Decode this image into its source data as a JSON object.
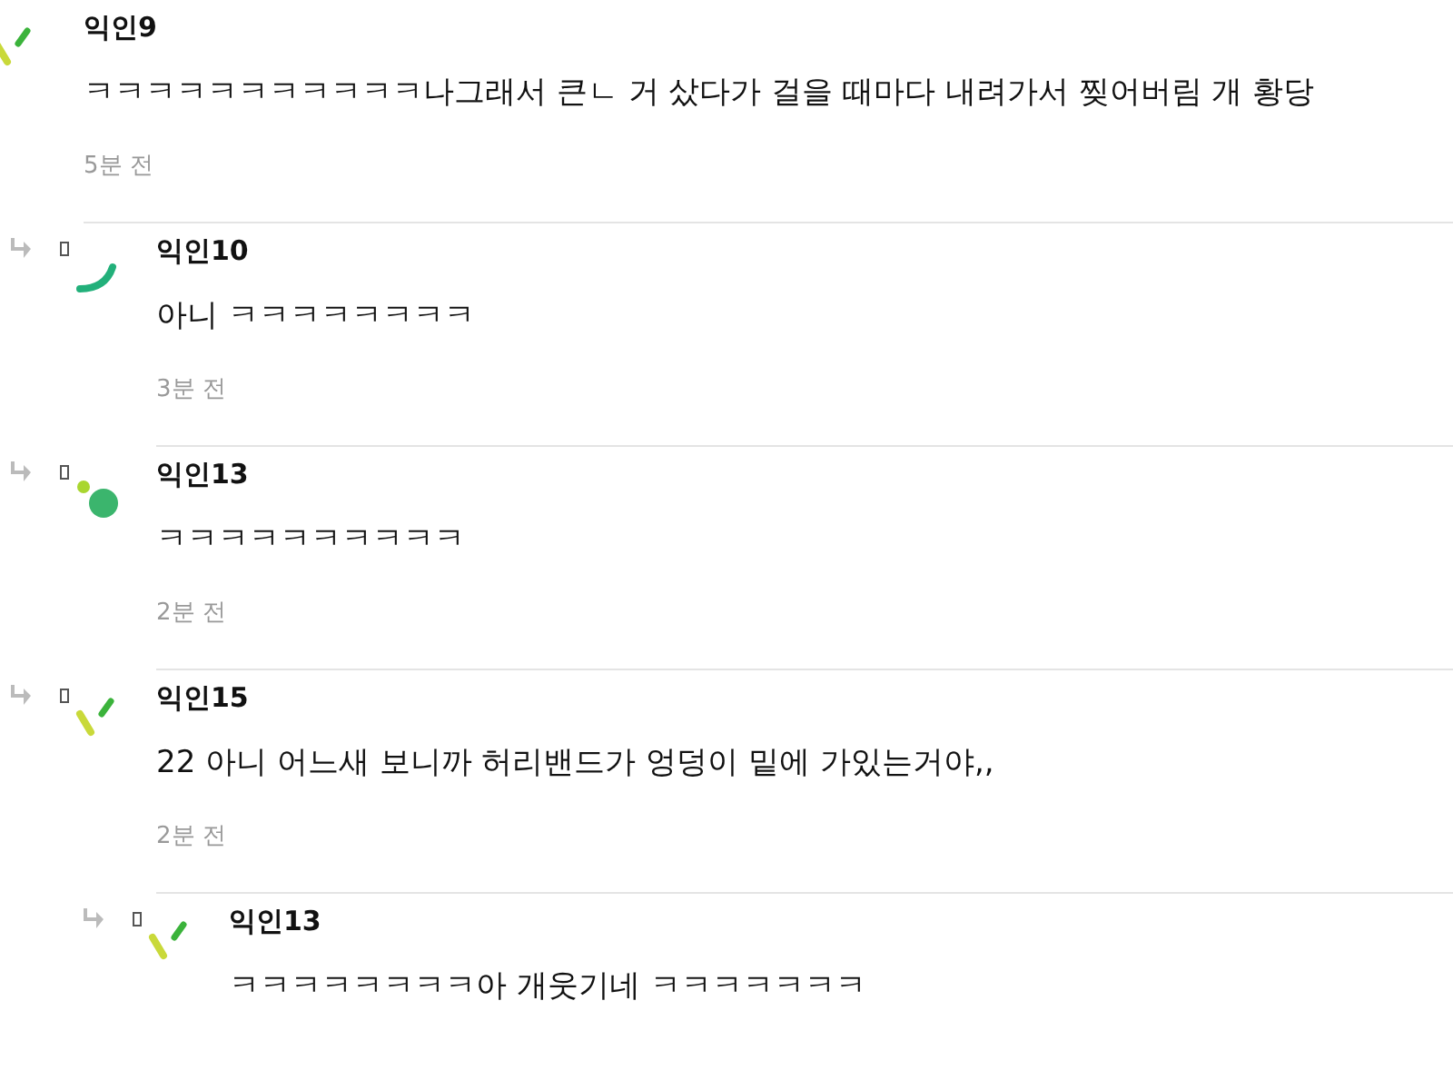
{
  "comments": [
    {
      "author": "익인9",
      "avatar": {
        "kind": "dashes"
      },
      "text": "ㅋㅋㅋㅋㅋㅋㅋㅋㅋㅋㅋ나그래서 큰ㄴ 거 샀다가 걸을 때마다 내려가서 찢어버림 개 황당",
      "time": "5분 전",
      "replies": [
        {
          "author": "익인10",
          "avatar": {
            "kind": "arc"
          },
          "text": "아니 ㅋㅋㅋㅋㅋㅋㅋㅋ",
          "time": "3분 전"
        },
        {
          "author": "익인13",
          "avatar": {
            "kind": "dots"
          },
          "text": "ㅋㅋㅋㅋㅋㅋㅋㅋㅋㅋ",
          "time": "2분 전"
        },
        {
          "author": "익인15",
          "avatar": {
            "kind": "dashes"
          },
          "text": "22 아니 어느새 보니까 허리밴드가 엉덩이 밑에 가있는거야,,",
          "time": "2분 전",
          "replies": [
            {
              "author": "익인13",
              "avatar": {
                "kind": "dashes"
              },
              "text": "ㅋㅋㅋㅋㅋㅋㅋㅋ아 개웃기네 ㅋㅋㅋㅋㅋㅋㅋ"
            }
          ]
        }
      ]
    }
  ]
}
